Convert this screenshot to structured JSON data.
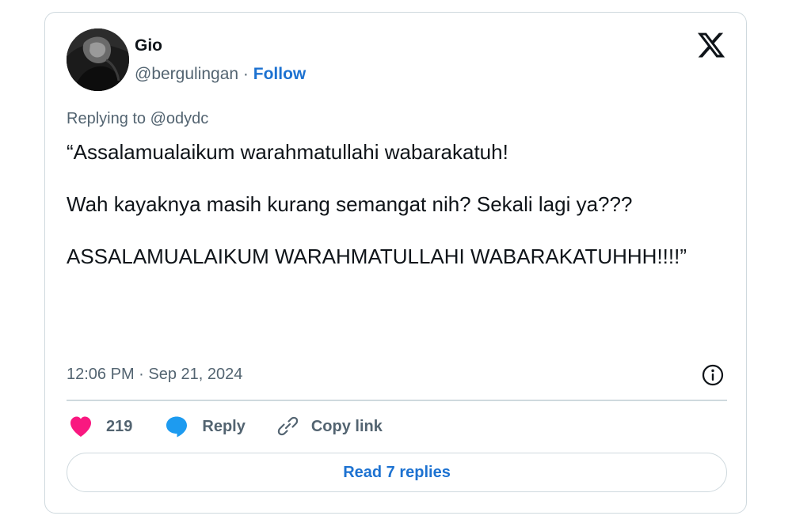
{
  "author": {
    "name": "Gio",
    "handle": "@bergulingan",
    "separator": "·",
    "follow_label": "Follow"
  },
  "reply_context": "Replying to @odydc",
  "tweet": {
    "text": "“Assalamualaikum warahmatullahi wabarakatuh!\n\nWah kayaknya masih kurang semangat nih? Sekali lagi ya???\n\nASSALAMUALAIKUM WARAHMATULLAHI WABARAKATUHHH!!!!”",
    "timestamp": "12:06 PM · Sep 21, 2024"
  },
  "actions": {
    "like_count": "219",
    "reply_label": "Reply",
    "copy_link_label": "Copy link"
  },
  "read_replies_label": "Read 7 replies",
  "colors": {
    "accent": "#1d72d1",
    "like": "#f91880",
    "reply_icon": "#1d9bf0",
    "secondary_text": "#536471",
    "border": "#cfd9de"
  },
  "icons": {
    "brand": "x-logo-icon",
    "info": "info-icon",
    "like": "heart-icon",
    "reply": "speech-bubble-icon",
    "copy": "link-icon"
  }
}
